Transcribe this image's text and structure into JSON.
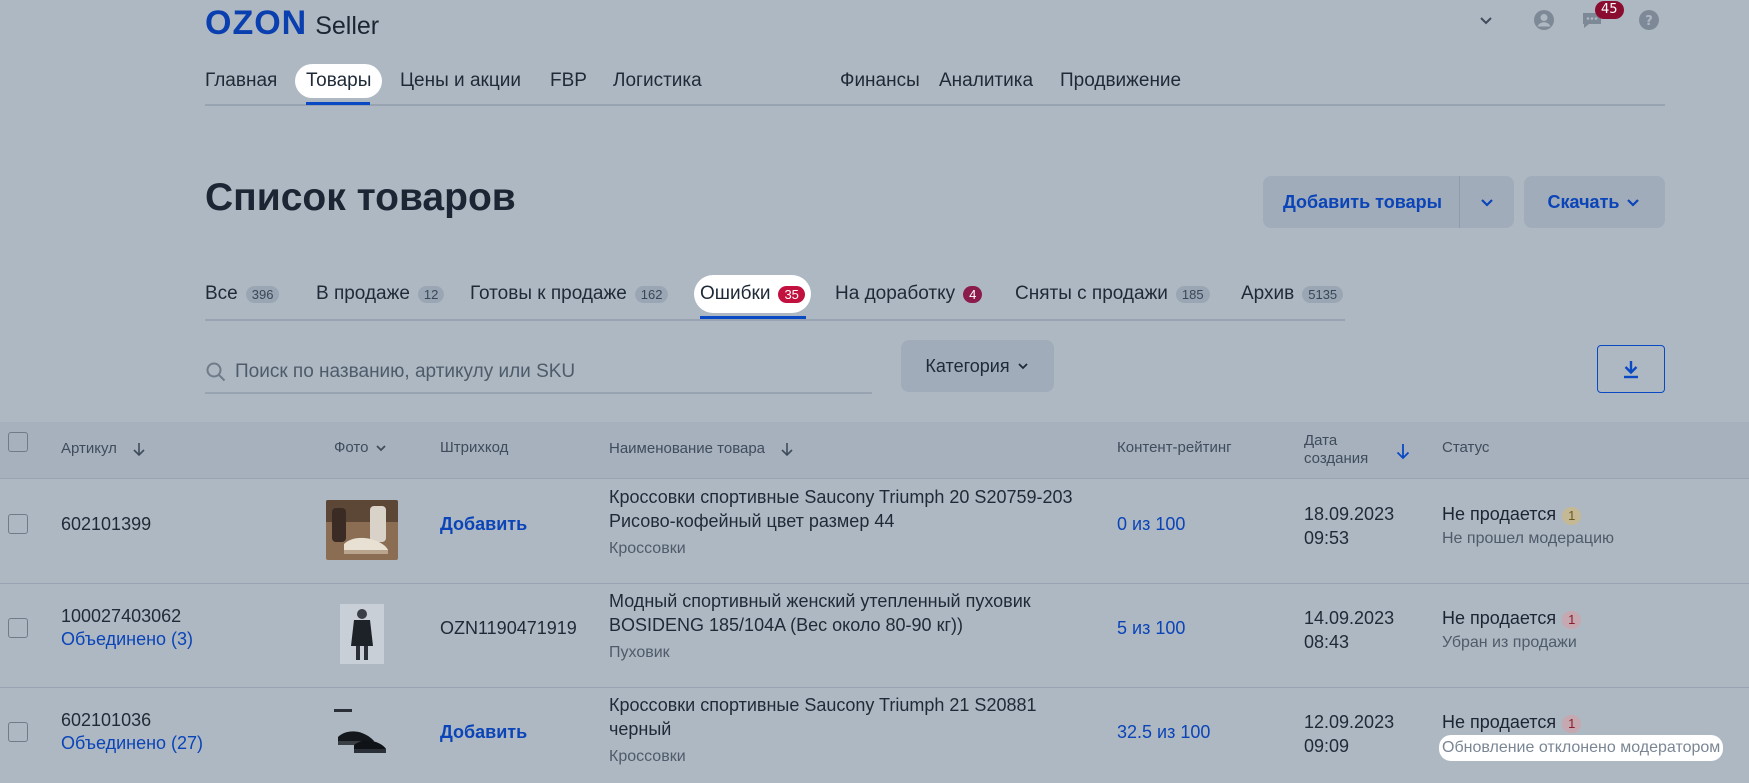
{
  "header": {
    "logo_main": "OZON",
    "logo_sub": "Seller",
    "chat_badge": "45"
  },
  "nav": {
    "items": [
      "Главная",
      "Товары",
      "Цены и акции",
      "FBP",
      "Логистика",
      "Финансы",
      "Аналитика",
      "Продвижение"
    ]
  },
  "page": {
    "title": "Список товаров",
    "add_button": "Добавить товары",
    "download_button": "Скачать"
  },
  "tabs": [
    {
      "label": "Все",
      "count": "396"
    },
    {
      "label": "В продаже",
      "count": "12"
    },
    {
      "label": "Готовы к продаже",
      "count": "162"
    },
    {
      "label": "Ошибки",
      "count": "35"
    },
    {
      "label": "На доработку",
      "count": "4"
    },
    {
      "label": "Сняты с продажи",
      "count": "185"
    },
    {
      "label": "Архив",
      "count": "5135"
    }
  ],
  "filters": {
    "search_placeholder": "Поиск по названию, артикулу или SKU",
    "category": "Категория"
  },
  "table": {
    "headers": {
      "article": "Артикул",
      "photo": "Фото",
      "barcode": "Штрихкод",
      "name": "Наименование товара",
      "rating": "Контент-рейтинг",
      "date_line1": "Дата",
      "date_line2": "создания",
      "status": "Статус"
    },
    "rows": [
      {
        "article": "602101399",
        "merged": "",
        "barcode": "Добавить",
        "name": "Кроссовки спортивные Saucony Triumph 20 S20759-203 Рисово-кофейный цвет размер 44",
        "category": "Кроссовки",
        "rating": "0 из 100",
        "date": "18.09.2023",
        "time": "09:53",
        "status": "Не продается",
        "status_count": "1",
        "status_sub": "Не прошел модерацию"
      },
      {
        "article": "100027403062",
        "merged": "Объединено (3)",
        "barcode": "OZN1190471919",
        "name": "Модный спортивный женский утепленный пуховик BOSIDENG 185/104A (Вес около 80-90 кг))",
        "category": "Пуховик",
        "rating": "5 из 100",
        "date": "14.09.2023",
        "time": "08:43",
        "status": "Не продается",
        "status_count": "1",
        "status_sub": "Убран из продажи"
      },
      {
        "article": "602101036",
        "merged": "Объединено (27)",
        "barcode": "Добавить",
        "name": "Кроссовки спортивные Saucony Triumph 21 S20881 черный",
        "category": "Кроссовки",
        "rating": "32.5 из 100",
        "date": "12.09.2023",
        "time": "09:09",
        "status": "Не продается",
        "status_count": "1",
        "status_sub": "Обновление отклонено модератором"
      }
    ]
  }
}
